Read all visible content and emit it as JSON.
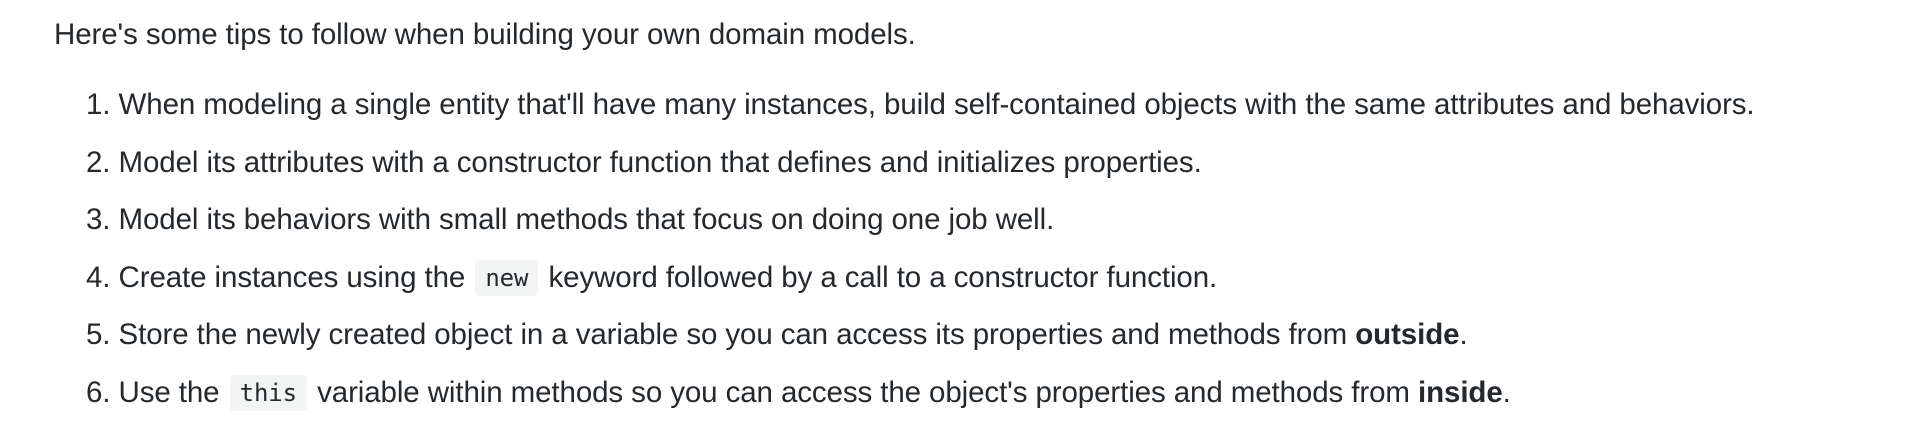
{
  "intro": "Here's some tips to follow when building your own domain models.",
  "tips": [
    {
      "number": "1.",
      "text": "When modeling a single entity that'll have many instances, build self-contained objects with the same attributes and behaviors."
    },
    {
      "number": "2.",
      "text": "Model its attributes with a constructor function that defines and initializes properties."
    },
    {
      "number": "3.",
      "text": "Model its behaviors with small methods that focus on doing one job well."
    },
    {
      "number": "4.",
      "before": "Create instances using the",
      "code": "new",
      "after": "keyword followed by a call to a constructor function."
    },
    {
      "number": "5.",
      "before": "Store the newly created object in a variable so you can access its properties and methods from",
      "bold": "outside",
      "after": "."
    },
    {
      "number": "6.",
      "before": "Use the",
      "code": "this",
      "middle": "variable within methods so you can access the object's properties and methods from",
      "bold": "inside",
      "after": "."
    }
  ]
}
